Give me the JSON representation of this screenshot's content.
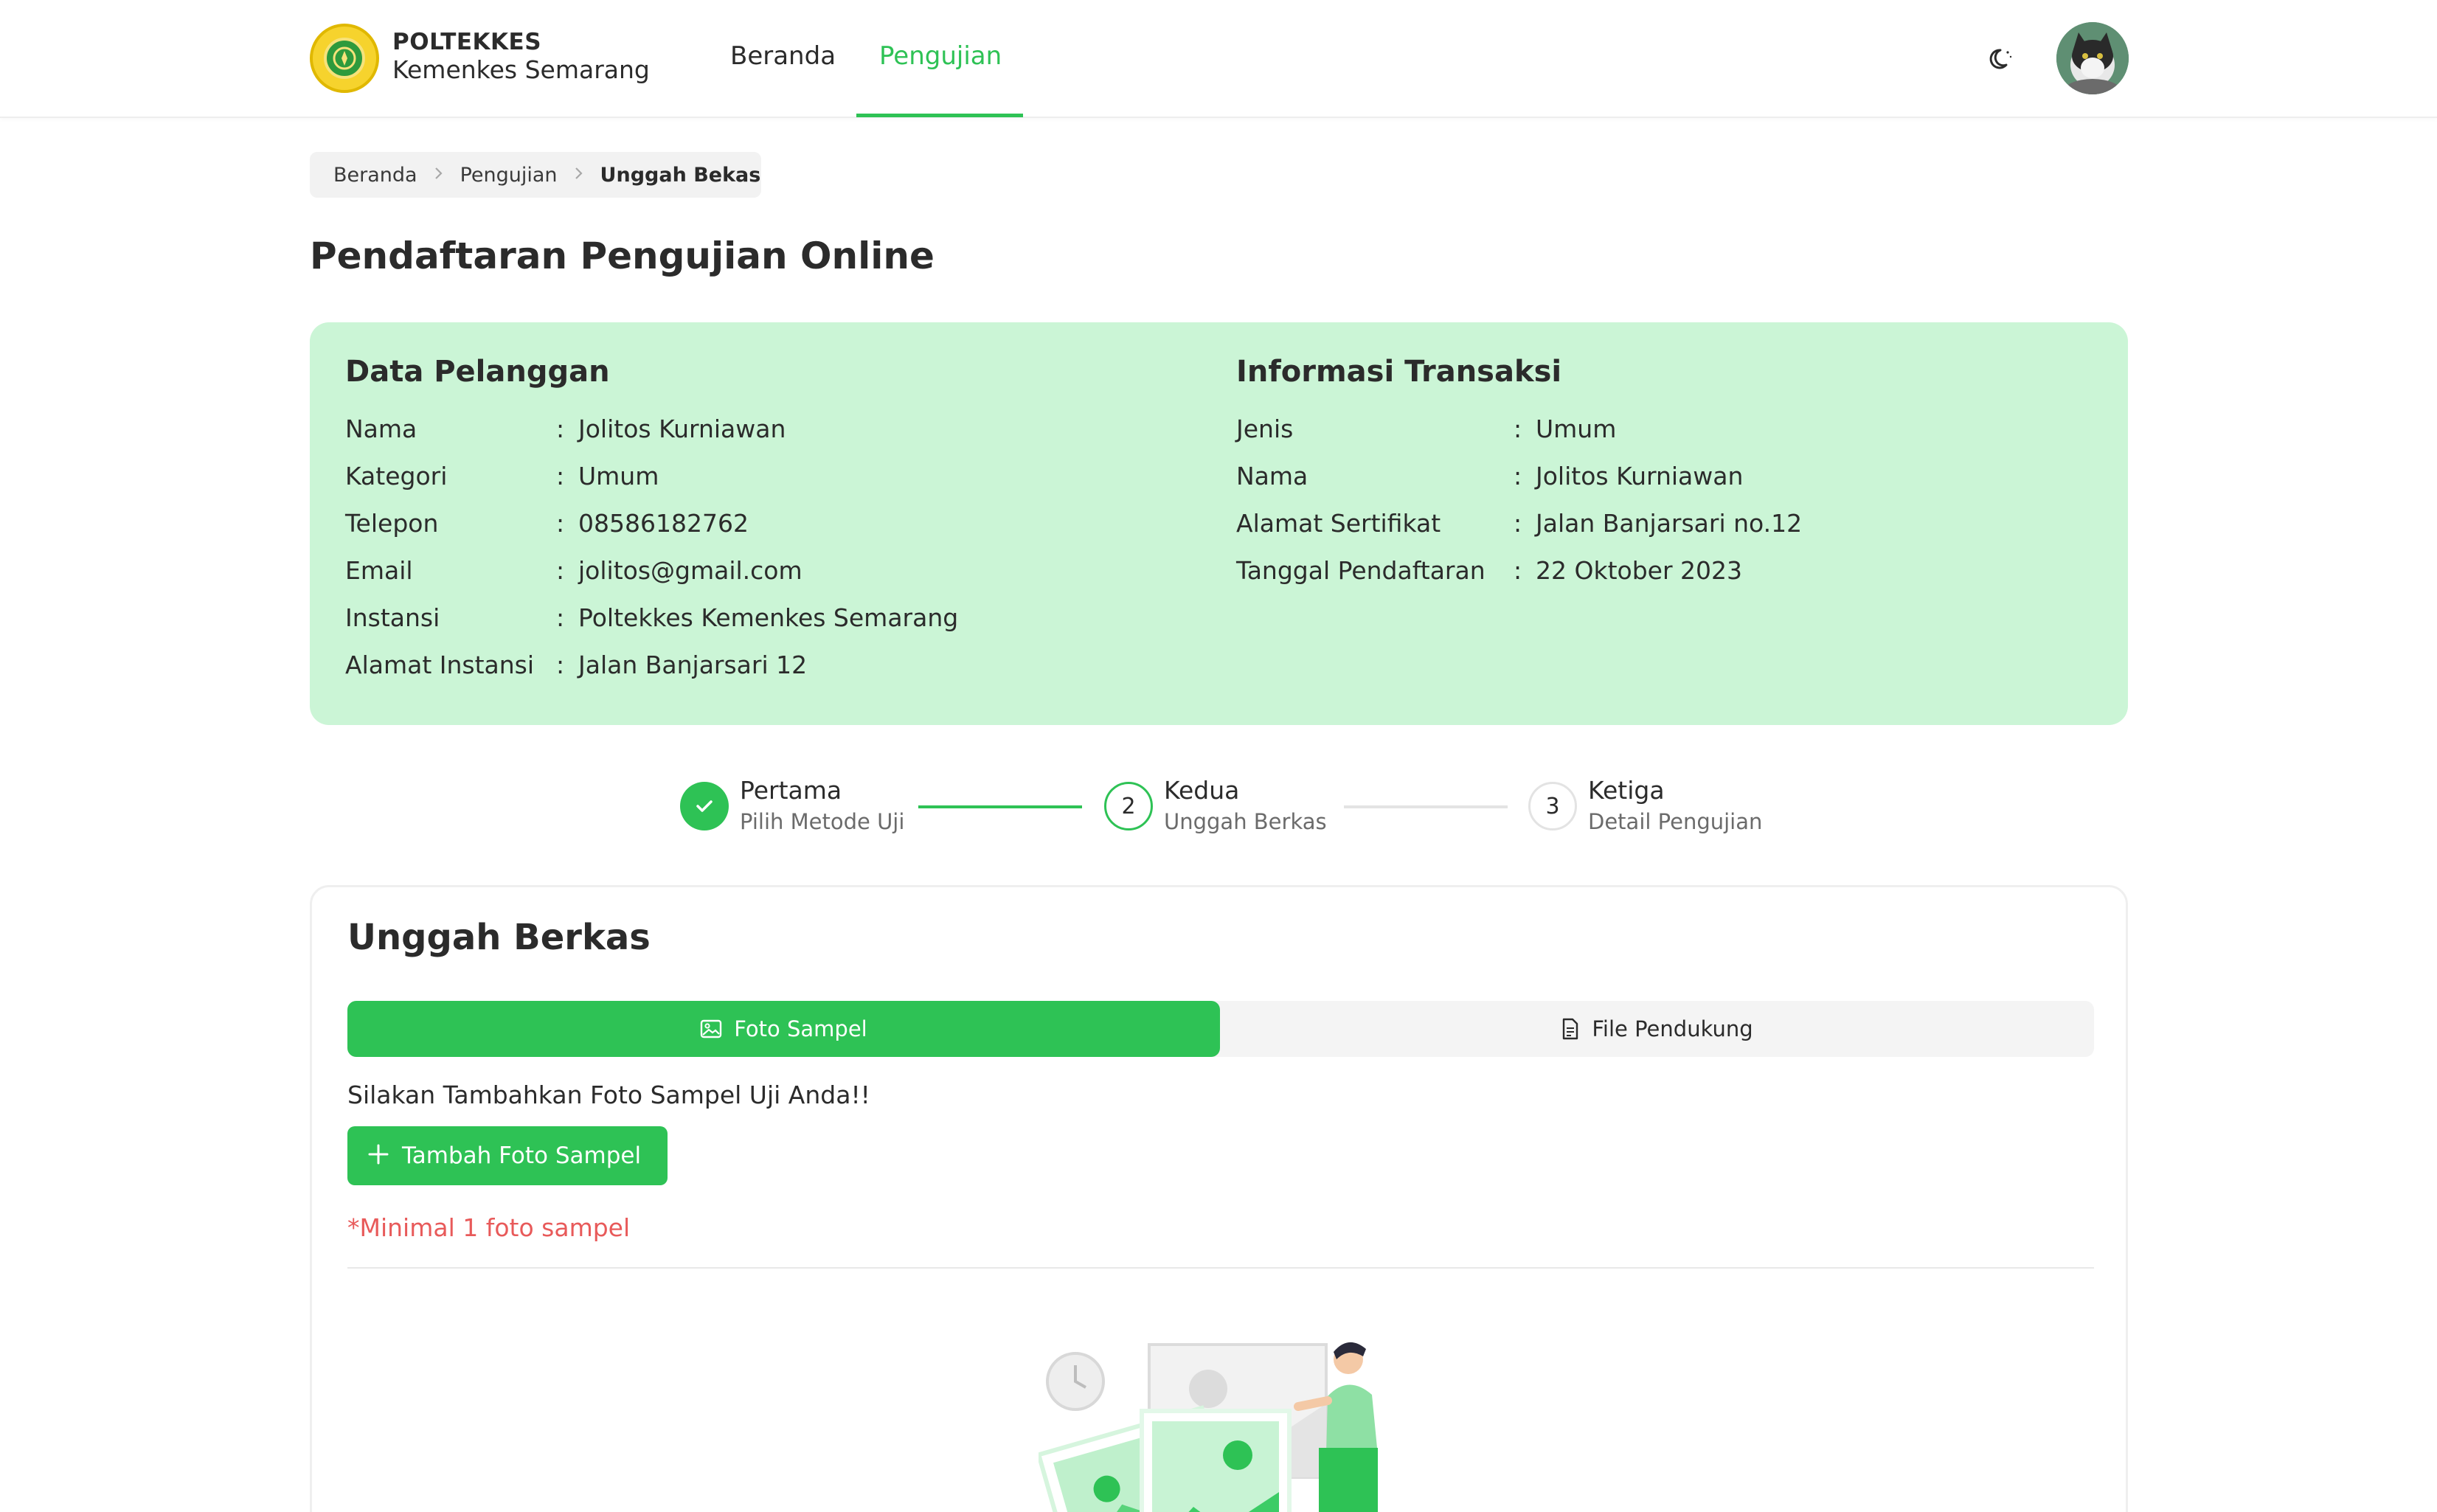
{
  "brand": {
    "name_top": "POLTEKKES",
    "name_bottom": "Kemenkes Semarang"
  },
  "nav": {
    "items": [
      {
        "label": "Beranda",
        "active": false
      },
      {
        "label": "Pengujian",
        "active": true
      }
    ]
  },
  "colors": {
    "accent": "#2ec255",
    "card_bg": "#cbf5d6",
    "warning": "#e85a5a"
  },
  "icons": {
    "theme_toggle": "moon-icon",
    "breadcrumb_separator": "chevron-right-icon",
    "step_done": "check-icon",
    "tab_foto": "image-icon",
    "tab_file": "document-icon",
    "add": "plus-icon"
  },
  "breadcrumb": {
    "items": [
      {
        "label": "Beranda"
      },
      {
        "label": "Pengujian"
      },
      {
        "label": "Unggah Bekas"
      }
    ]
  },
  "page": {
    "title": "Pendaftaran Pengujian Online"
  },
  "customer": {
    "heading": "Data Pelanggan",
    "rows": [
      {
        "label": "Nama",
        "value": "Jolitos Kurniawan"
      },
      {
        "label": "Kategori",
        "value": "Umum"
      },
      {
        "label": "Telepon",
        "value": "08586182762"
      },
      {
        "label": "Email",
        "value": "jolitos@gmail.com"
      },
      {
        "label": "Instansi",
        "value": "Poltekkes Kemenkes Semarang"
      },
      {
        "label": "Alamat Instansi",
        "value": "Jalan Banjarsari 12"
      }
    ]
  },
  "transaction": {
    "heading": "Informasi Transaksi",
    "rows": [
      {
        "label": "Jenis",
        "value": "Umum"
      },
      {
        "label": "Nama",
        "value": "Jolitos Kurniawan"
      },
      {
        "label": "Alamat Sertifikat",
        "value": "Jalan Banjarsari no.12"
      },
      {
        "label": "Tanggal Pendaftaran",
        "value": "22 Oktober 2023"
      }
    ]
  },
  "separator": ":",
  "stepper": {
    "steps": [
      {
        "number": "1",
        "title": "Pertama",
        "subtitle": "Pilih Metode Uji",
        "status": "done"
      },
      {
        "number": "2",
        "title": "Kedua",
        "subtitle": "Unggah Berkas",
        "status": "current"
      },
      {
        "number": "3",
        "title": "Ketiga",
        "subtitle": "Detail Pengujian",
        "status": "pending"
      }
    ]
  },
  "upload": {
    "title": "Unggah Berkas",
    "tabs": [
      {
        "label": "Foto Sampel",
        "active": true
      },
      {
        "label": "File Pendukung",
        "active": false
      }
    ],
    "hint": "Silakan Tambahkan Foto Sampel Uji Anda!!",
    "add_button_label": "Tambah Foto Sampel",
    "warning": "*Minimal 1 foto sampel"
  }
}
